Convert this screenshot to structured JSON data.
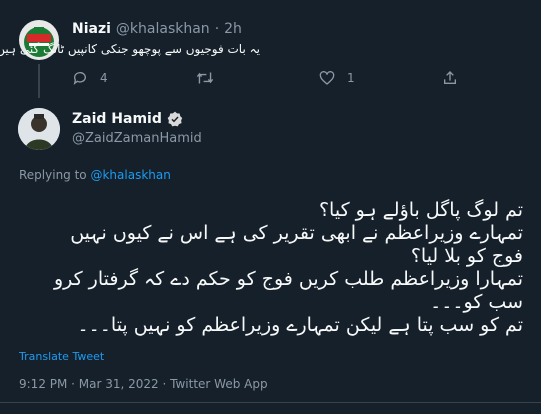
{
  "parent_tweet": {
    "name": "Niazi",
    "handle": "@khalaskhan",
    "time": "2h",
    "text": "یہ بات فوجیوں سے پوچھو جنکی کانپیں ٹانگ گئی ہیں",
    "reply_count": "4",
    "like_count": "1"
  },
  "main_tweet": {
    "name": "Zaid Hamid",
    "handle": "@ZaidZamanHamid",
    "replying_prefix": "Replying to",
    "replying_handle": "@khalaskhan",
    "lines": [
      "تم لوگ پاگل باؤلے ہو کیا؟",
      "تمہارے وزیراعظم نے ابھی تقریر کی ہے اس نے کیوں نہیں",
      "فوج کو بلا لیا؟",
      "تمہارا وزیراعظم طلب کریں فوج کو حکم دے کہ گرفتار کرو",
      "سب کو۔۔۔",
      "تم کو سب پتا ہے لیکن تمہارے وزیراعظم کو نہیں پتا۔۔۔"
    ],
    "translate_label": "Translate Tweet",
    "timestamp": "9:12 PM · Mar 31, 2022 · Twitter Web App"
  },
  "icons": {
    "reply": "comment-icon",
    "retweet": "retweet-icon",
    "like": "heart-icon",
    "share": "share-icon",
    "verified": "verified-badge-icon"
  },
  "colors": {
    "background": "#15202b",
    "text": "#f7f9f9",
    "muted": "#8b98a5",
    "link": "#1d9bf0",
    "divider": "#38444d"
  }
}
